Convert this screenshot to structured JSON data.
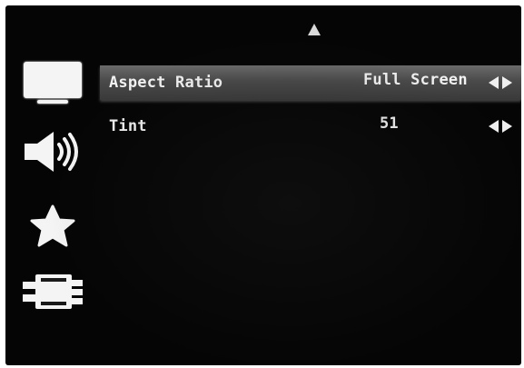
{
  "sidebar": {
    "items": [
      {
        "icon": "tv-icon",
        "active": true
      },
      {
        "icon": "speaker-icon",
        "active": false
      },
      {
        "icon": "star-icon",
        "active": false
      },
      {
        "icon": "connector-icon",
        "active": false
      }
    ]
  },
  "menu": {
    "rows": [
      {
        "label": "Aspect Ratio",
        "value": "Full Screen",
        "selected": true
      },
      {
        "label": "Tint",
        "value": "51",
        "selected": false
      }
    ]
  }
}
